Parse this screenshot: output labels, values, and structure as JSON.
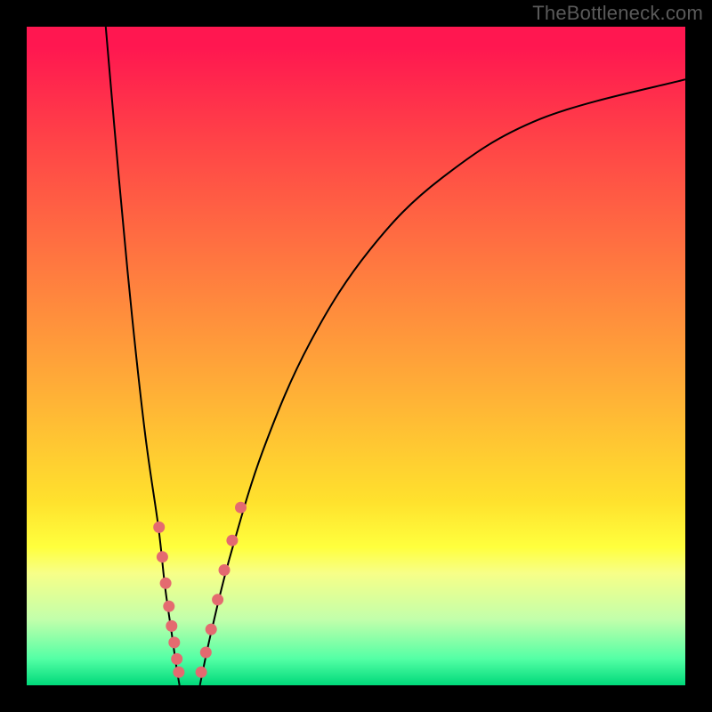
{
  "watermark": "TheBottleneck.com",
  "colors": {
    "frame": "#000000",
    "curve": "#000000",
    "marker": "#e46a70",
    "gradient_top": "#ff1750",
    "gradient_mid": "#ffe12d",
    "gradient_bottom": "#00d97a"
  },
  "chart_data": {
    "type": "line",
    "title": "",
    "xlabel": "",
    "ylabel": "",
    "xlim": [
      0,
      100
    ],
    "ylim": [
      0,
      100
    ],
    "note": "Two V-shaped curves drawn over a vertical red→yellow→green gradient. Values below are estimated pixel-normalized coordinates (0–100 each axis) read off the figure; no axis ticks or labels are visible.",
    "series": [
      {
        "name": "left-curve",
        "x": [
          12,
          14,
          16,
          18,
          20,
          21,
          22,
          22.7,
          23.2
        ],
        "y": [
          100,
          77,
          56,
          38,
          24,
          15,
          8,
          3,
          0
        ]
      },
      {
        "name": "right-curve",
        "x": [
          26.3,
          28,
          31,
          36,
          43,
          52,
          63,
          78,
          100
        ],
        "y": [
          0,
          8,
          20,
          36,
          52,
          66,
          77,
          86,
          92
        ]
      },
      {
        "name": "markers-left",
        "style": "points",
        "x": [
          20.1,
          20.6,
          21.1,
          21.6,
          22.0,
          22.4,
          22.8,
          23.1
        ],
        "y": [
          24,
          19.5,
          15.5,
          12,
          9,
          6.5,
          4,
          2
        ]
      },
      {
        "name": "markers-right",
        "style": "points",
        "x": [
          26.5,
          27.2,
          28.0,
          29.0,
          30.0,
          31.2,
          32.5
        ],
        "y": [
          2,
          5,
          8.5,
          13,
          17.5,
          22,
          27
        ]
      }
    ]
  }
}
